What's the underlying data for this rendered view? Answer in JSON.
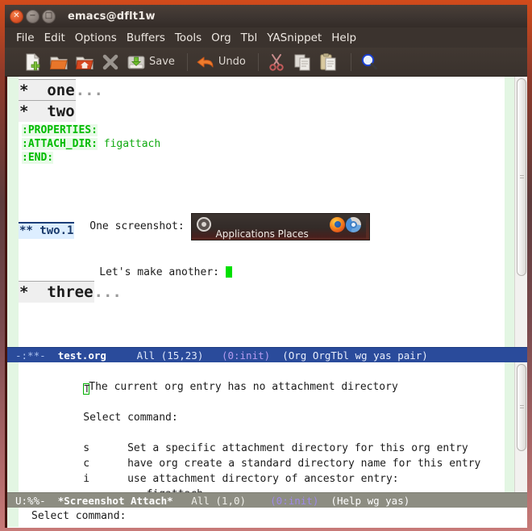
{
  "window": {
    "title": "emacs@dflt1w",
    "buttons": [
      {
        "name": "close",
        "glyph": "✕"
      },
      {
        "name": "minimize",
        "glyph": "−"
      },
      {
        "name": "maximize",
        "glyph": "□"
      }
    ]
  },
  "menubar": {
    "items": [
      {
        "label": "File"
      },
      {
        "label": "Edit"
      },
      {
        "label": "Options"
      },
      {
        "label": "Buffers"
      },
      {
        "label": "Tools"
      },
      {
        "label": "Org"
      },
      {
        "label": "Tbl"
      },
      {
        "label": "YASnippet"
      },
      {
        "label": "Help"
      }
    ]
  },
  "toolbar": {
    "items": [
      {
        "icon": "new-file-icon",
        "label": ""
      },
      {
        "icon": "open-file-icon",
        "label": ""
      },
      {
        "icon": "open-home-folder-icon",
        "label": ""
      },
      {
        "icon": "close-file-icon",
        "label": ""
      },
      {
        "icon": "save-icon",
        "label": "Save"
      },
      {
        "icon": "undo-icon",
        "label": "Undo"
      },
      {
        "icon": "cut-icon",
        "label": ""
      },
      {
        "icon": "copy-icon",
        "label": ""
      },
      {
        "icon": "paste-icon",
        "label": ""
      },
      {
        "icon": "search-icon",
        "label": ""
      }
    ]
  },
  "buffer": {
    "headline_one": {
      "stars": "*",
      "text": "one",
      "ellipsis": "..."
    },
    "headline_two": {
      "stars": "*",
      "text": "two"
    },
    "properties": {
      "open": ":PROPERTIES:",
      "key": ":ATTACH_DIR:",
      "value": "figattach",
      "end": ":END:"
    },
    "screenshot_line": {
      "label": "One screenshot:",
      "image": {
        "panel_text": "Applications  Places",
        "icons": [
          "ubuntu-logo-icon",
          "firefox-icon",
          "chrome-icon"
        ]
      }
    },
    "headline_two_one": {
      "stars": "**",
      "text": "two.1"
    },
    "another_line": {
      "label": "Let's make another:"
    },
    "headline_three": {
      "stars": "*",
      "text": "three",
      "ellipsis": "..."
    }
  },
  "modeline_top": {
    "flags": "-:**-",
    "buffer": "test.org",
    "percent": "All",
    "position": "(15,23)",
    "init": "(0:init)",
    "minor_modes": "(Org OrgTbl wg yas pair)"
  },
  "help_buffer": {
    "message": "The current org entry has no attachment directory",
    "prompt": "Select command:",
    "commands": [
      {
        "key": "s",
        "description": "Set a specific attachment directory for this org entry"
      },
      {
        "key": "c",
        "description": "have org create a standard directory name for this entry"
      },
      {
        "key": "i",
        "description": "use attachment directory of ancestor entry:"
      }
    ],
    "ancestor_dir": "figattach"
  },
  "modeline_bottom": {
    "flags": "U:%%-",
    "buffer": "*Screenshot Attach*",
    "percent": "All",
    "position": "(1,0)",
    "init": "(0:init)",
    "minor_modes": "(Help wg yas)"
  },
  "minibuffer": {
    "text": "Select command:"
  }
}
